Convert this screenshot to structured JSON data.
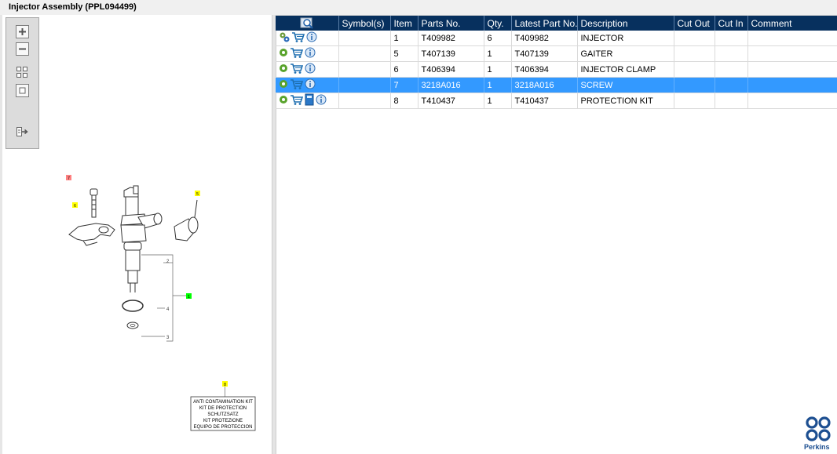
{
  "window": {
    "title": "Injector Assembly (PPL094499)"
  },
  "toolbar": {
    "buttons": [
      {
        "name": "zoom-in-icon"
      },
      {
        "name": "zoom-out-icon"
      },
      {
        "name": "fit-all-icon"
      },
      {
        "name": "fit-page-icon"
      },
      {
        "name": "export-icon"
      }
    ]
  },
  "table": {
    "columns": [
      "",
      "Symbol(s)",
      "Item",
      "Parts No.",
      "Qty.",
      "Latest Part No.",
      "Description",
      "Cut Out",
      "Cut In",
      "Comment"
    ],
    "rows": [
      {
        "icons": [
          "gears-icon",
          "cart-icon",
          "info-icon"
        ],
        "symbols": "",
        "item": "1",
        "part_no": "T409982",
        "qty": "6",
        "latest_part_no": "T409982",
        "description": "INJECTOR",
        "cut_out": "",
        "cut_in": "",
        "comment": "",
        "selected": false
      },
      {
        "icons": [
          "gear-icon",
          "cart-icon",
          "info-icon"
        ],
        "symbols": "",
        "item": "5",
        "part_no": "T407139",
        "qty": "1",
        "latest_part_no": "T407139",
        "description": "GAITER",
        "cut_out": "",
        "cut_in": "",
        "comment": "",
        "selected": false
      },
      {
        "icons": [
          "gear-icon",
          "cart-icon",
          "info-icon"
        ],
        "symbols": "",
        "item": "6",
        "part_no": "T406394",
        "qty": "1",
        "latest_part_no": "T406394",
        "description": "INJECTOR CLAMP",
        "cut_out": "",
        "cut_in": "",
        "comment": "",
        "selected": false
      },
      {
        "icons": [
          "gear-icon",
          "cart-icon",
          "info-icon"
        ],
        "symbols": "",
        "item": "7",
        "part_no": "3218A016",
        "qty": "1",
        "latest_part_no": "3218A016",
        "description": "SCREW",
        "cut_out": "",
        "cut_in": "",
        "comment": "",
        "selected": true
      },
      {
        "icons": [
          "gear-icon",
          "cart-icon",
          "book-icon",
          "info-icon"
        ],
        "symbols": "",
        "item": "8",
        "part_no": "T410437",
        "qty": "1",
        "latest_part_no": "T410437",
        "description": "PROTECTION KIT",
        "cut_out": "",
        "cut_in": "",
        "comment": "",
        "selected": false
      }
    ]
  },
  "diagram": {
    "callouts": {
      "c7": "7",
      "c6": "6",
      "c5": "5",
      "c1": "1",
      "c2": "2",
      "c4": "4",
      "c3": "3",
      "c8": "8"
    },
    "kit_label_lines": [
      "ANTI CONTAMINATION KIT",
      "KIT DE PROTECTION",
      "SCHUTZSATZ",
      "KIT PROTEZIONE",
      "EQUIPO DE PROTECCION"
    ]
  },
  "branding": {
    "logo_text": "Perkins"
  },
  "colors": {
    "header": "#07305e",
    "selected_row": "#3399ff",
    "callout_yellow": "#ffff00",
    "callout_green": "#00ff00",
    "callout_red": "#ff8080",
    "logo_blue": "#1d4f91"
  }
}
